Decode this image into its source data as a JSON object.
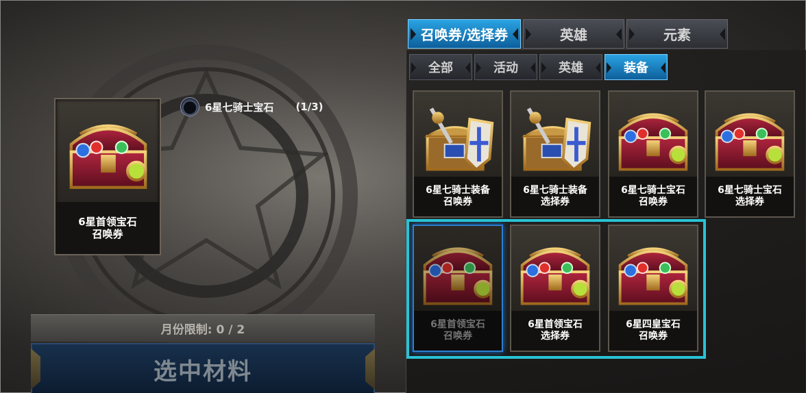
{
  "main_tabs": [
    {
      "label": "召唤券/选择券",
      "active": true
    },
    {
      "label": "英雄",
      "active": false
    },
    {
      "label": "元素",
      "active": false
    }
  ],
  "sub_tabs": [
    {
      "label": "全部",
      "active": false
    },
    {
      "label": "活动",
      "active": false
    },
    {
      "label": "英雄",
      "active": false
    },
    {
      "label": "装备",
      "active": true
    }
  ],
  "selected_item": {
    "line1": "6星首领宝石",
    "line2": "召唤券",
    "icon": "treasure-chest-icon"
  },
  "requirement": {
    "name": "6星七骑士宝石",
    "count": "(1/3)",
    "icon": "gem-slot-icon"
  },
  "limit_text": "月份限制: 0 / 2",
  "select_button": "选中材料",
  "items": [
    {
      "line1": "6星七骑士装备",
      "line2": "召唤券",
      "icon": "equipment-chest-icon",
      "selected": false
    },
    {
      "line1": "6星七骑士装备",
      "line2": "选择券",
      "icon": "equipment-chest-icon",
      "selected": false
    },
    {
      "line1": "6星七骑士宝石",
      "line2": "召唤券",
      "icon": "gem-chest-icon",
      "selected": false
    },
    {
      "line1": "6星七骑士宝石",
      "line2": "选择券",
      "icon": "gem-chest-icon",
      "selected": false
    },
    {
      "line1": "6星首领宝石",
      "line2": "召唤券",
      "icon": "gem-chest-icon",
      "selected": true
    },
    {
      "line1": "6星首领宝石",
      "line2": "选择券",
      "icon": "gem-chest-icon",
      "selected": false
    },
    {
      "line1": "6星四皇宝石",
      "line2": "召唤券",
      "icon": "gem-chest-icon",
      "selected": false
    }
  ],
  "colors": {
    "accent_blue": "#2aa3e3",
    "highlight_cyan": "#29c3d6",
    "chest_red": "#8c1a2f",
    "chest_gold": "#d9a441"
  }
}
